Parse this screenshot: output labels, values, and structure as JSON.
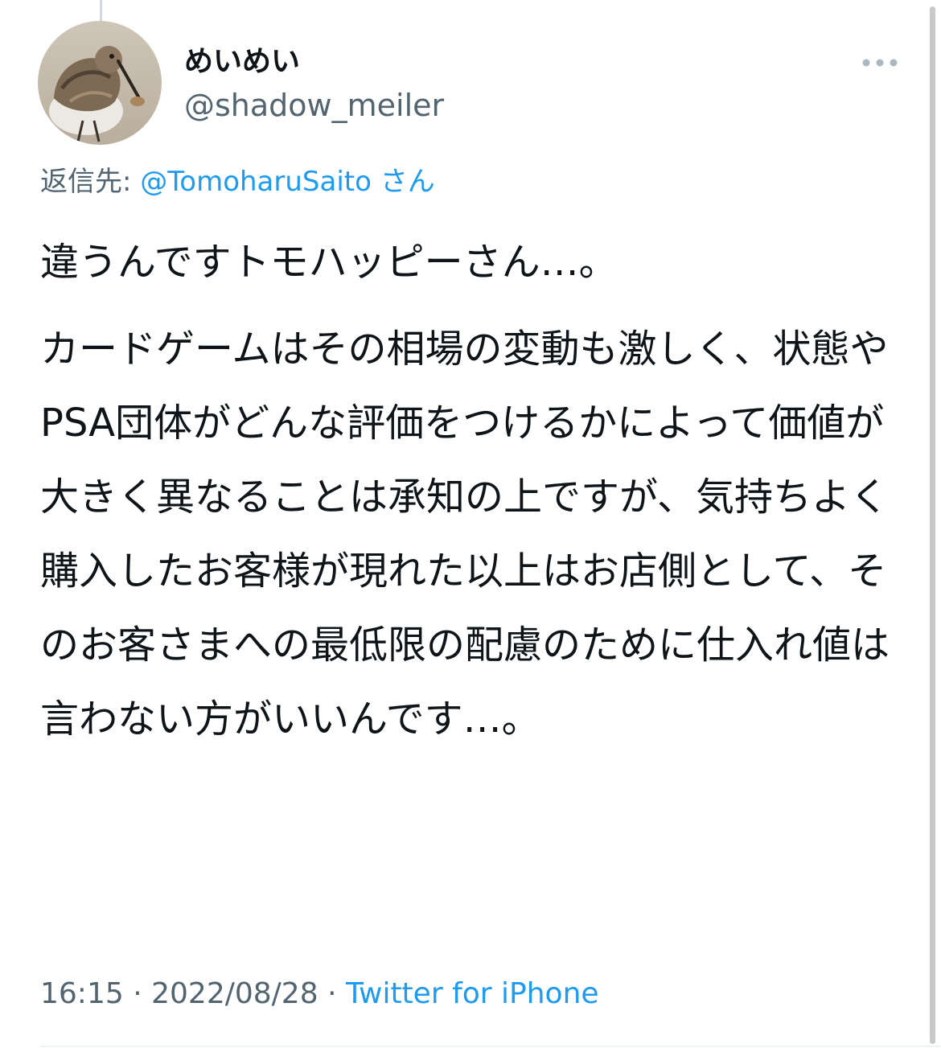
{
  "tweet": {
    "author": {
      "display_name": "めいめい",
      "handle": "@shadow_meiler",
      "avatar_icon": "bird-avatar-icon"
    },
    "more_icon": "more-dots-icon",
    "reply_to": {
      "prefix": "返信先:",
      "mention": "@TomoharuSaito",
      "suffix": "さん"
    },
    "paragraphs": [
      "違うんですトモハッピーさん…。",
      "カードゲームはその相場の変動も激しく、状態やPSA団体がどんな評価をつけるかによって価値が大きく異なることは承知の上ですが、気持ちよく購入したお客様が現れた以上はお店側として、そのお客さまへの最低限の配慮のために仕入れ値は言わない方がいいんです…。"
    ],
    "meta": {
      "time": "16:15",
      "separator": "·",
      "date": "2022/08/28",
      "source": "Twitter for iPhone"
    }
  },
  "colors": {
    "text": "#0f1419",
    "secondary": "#536471",
    "link": "#1d9bf0",
    "divider": "#eff3f4"
  }
}
